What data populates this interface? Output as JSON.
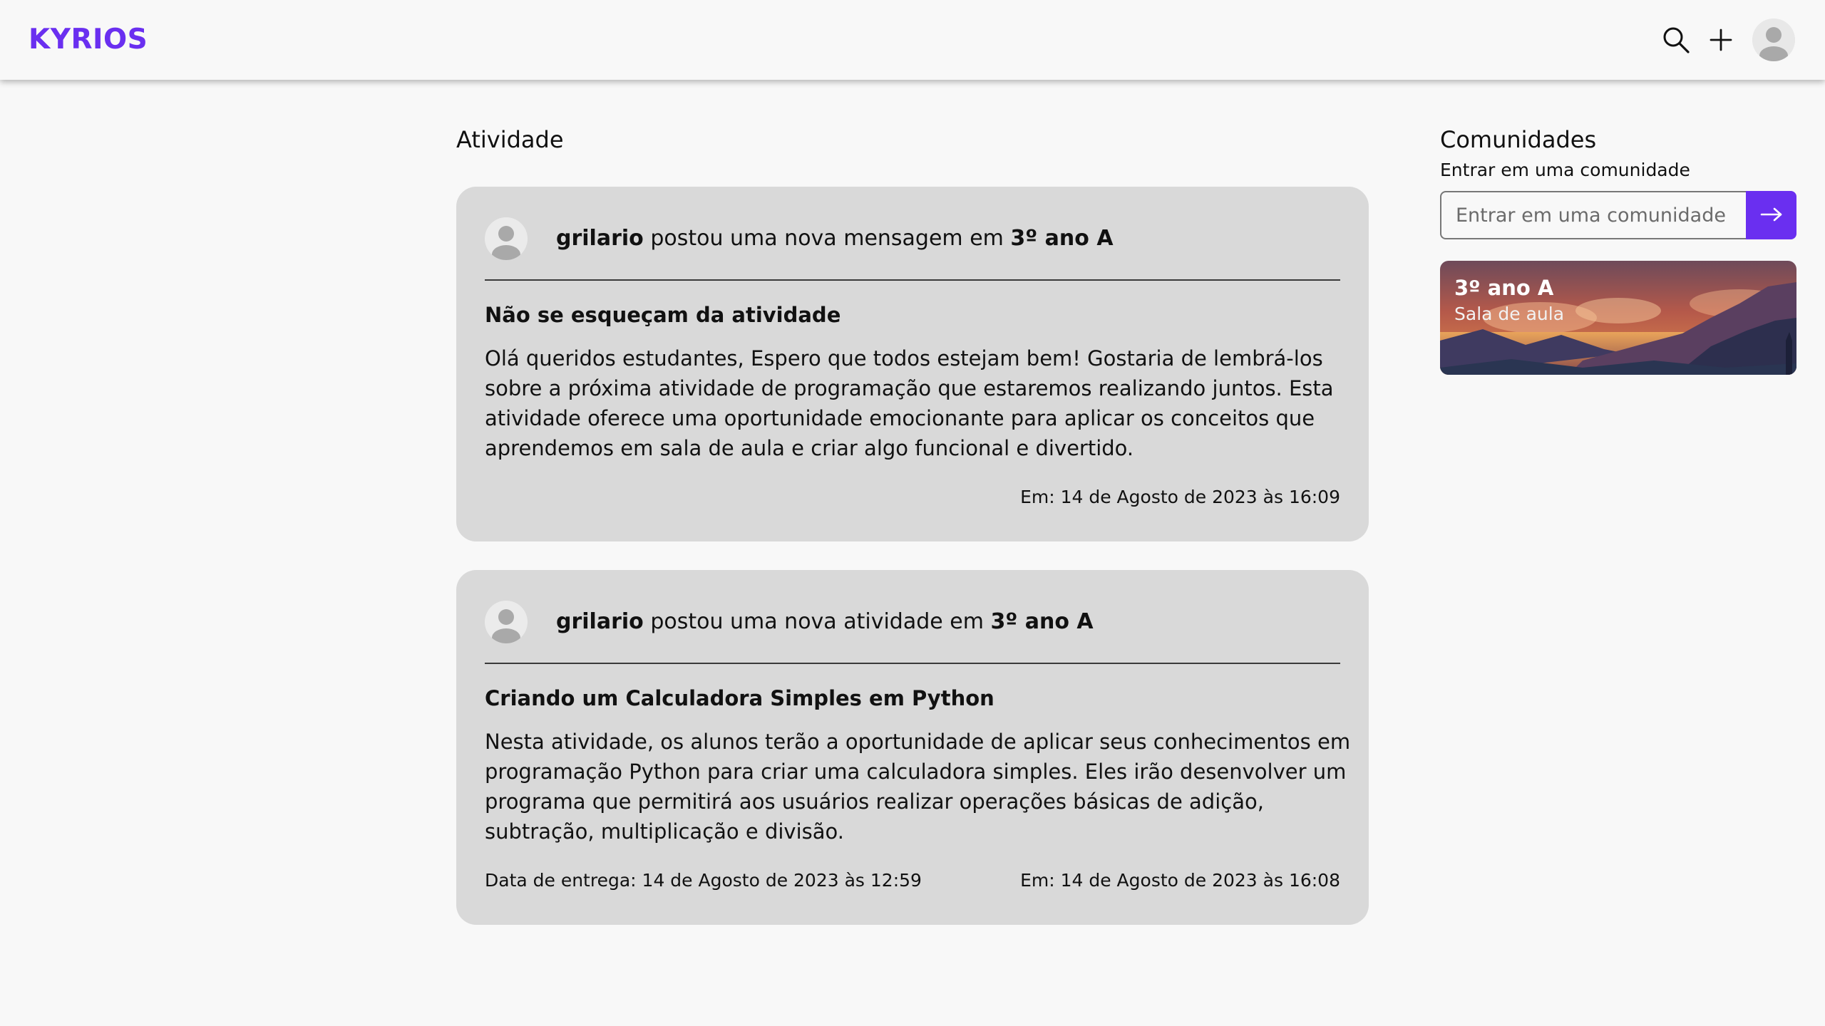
{
  "header": {
    "logo": "KYRIOS",
    "search_icon": "search-icon",
    "add_icon": "plus-icon",
    "avatar_icon": "user-avatar-icon"
  },
  "colors": {
    "brand": "#6a2ff0",
    "card_bg": "#d9d9d9",
    "page_bg": "#f8f8f8"
  },
  "activity": {
    "title": "Atividade",
    "posts": [
      {
        "author": "grilario",
        "action": "postou uma nova mensagem em",
        "community": "3º ano A",
        "subject": "Não se esqueçam da atividade",
        "body": "Olá queridos estudantes, Espero que todos estejam bem! Gostaria de lembrá-los sobre a próxima atividade de programação que estaremos realizando juntos. Esta atividade oferece uma oportunidade emocionante para aplicar os conceitos que aprendemos em sala de aula e criar algo funcional e divertido.",
        "posted_at": "Em: 14 de Agosto de 2023 às 16:09"
      },
      {
        "author": "grilario",
        "action": "postou uma nova atividade em",
        "community": "3º ano A",
        "subject": "Criando um Calculadora Simples em Python",
        "body": "Nesta atividade, os alunos terão a oportunidade de aplicar seus conhecimentos em programação Python para criar uma calculadora simples. Eles irão desenvolver um programa que permitirá aos usuários realizar operações básicas de adição, subtração, multiplicação e divisão.",
        "due_date": "Data de entrega: 14 de Agosto de 2023 às 12:59",
        "posted_at": "Em: 14 de Agosto de 2023 às 16:08"
      }
    ]
  },
  "communities": {
    "title": "Comunidades",
    "join_label": "Entrar em uma comunidade",
    "join_placeholder": "Entrar em uma comunidade",
    "join_button_icon": "arrow-right-icon",
    "items": [
      {
        "name": "3º ano A",
        "type": "Sala de aula"
      }
    ]
  }
}
